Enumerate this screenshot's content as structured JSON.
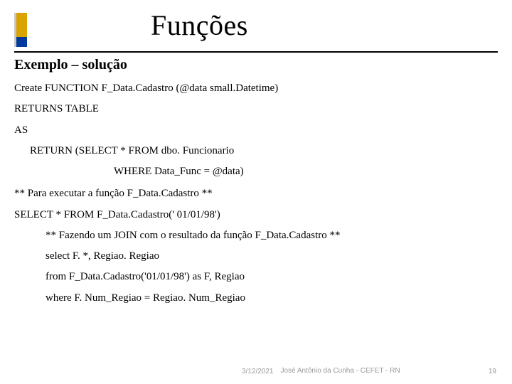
{
  "title": "Funções",
  "subtitle": "Exemplo – solução",
  "code": {
    "l1": "Create FUNCTION F_Data.Cadastro (@data small.Datetime)",
    "l2": "RETURNS TABLE",
    "l3": "AS",
    "l4": "RETURN (SELECT * FROM dbo. Funcionario",
    "l5": "WHERE Data_Func =  @data)",
    "l6": "** Para executar a função F_Data.Cadastro **",
    "l7": "SELECT * FROM F_Data.Cadastro(' 01/01/98')",
    "l8": "** Fazendo um JOIN com o resultado da função F_Data.Cadastro **",
    "l9": "select F. *, Regiao. Regiao",
    "l10": "from F_Data.Cadastro('01/01/98') as F, Regiao",
    "l11": "where F. Num_Regiao = Regiao. Num_Regiao"
  },
  "footer": {
    "date": "3/12/2021",
    "author": "José Antônio da Cunha - CEFET - RN",
    "pagenum": "19"
  }
}
